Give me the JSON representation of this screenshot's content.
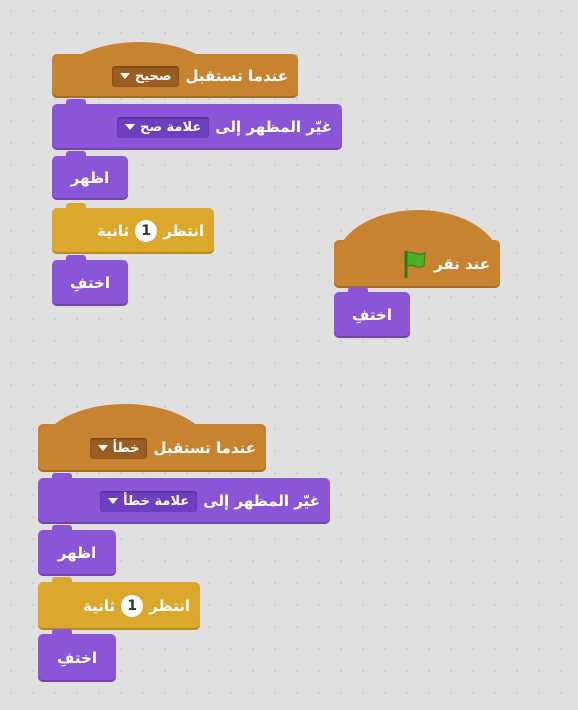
{
  "script1": {
    "when_receive_label": "عندما تستقبل",
    "message_value": "صحيح",
    "switch_label": "غيّر المظهر إلى",
    "costume_value": "علامة صح",
    "show_label": "اظهر",
    "wait_prefix": "انتظر",
    "wait_value": "1",
    "wait_suffix": "ثانية",
    "hide_label": "اختفِ"
  },
  "script2": {
    "flag_label": "عند نقر",
    "hide_label": "اختفِ"
  },
  "script3": {
    "when_receive_label": "عندما تستقبل",
    "message_value": "خطأ",
    "switch_label": "غيّر المظهر إلى",
    "costume_value": "علامة خطأ",
    "show_label": "اظهر",
    "wait_prefix": "انتظر",
    "wait_value": "1",
    "wait_suffix": "ثانية",
    "hide_label": "اختفِ"
  },
  "colors": {
    "events": "#c88330",
    "looks": "#8a55d7",
    "control": "#dba82d",
    "flag": "#4caf2a",
    "workspace": "#e0e0e0"
  },
  "icons": {
    "flag": "green-flag-icon",
    "dropdown": "dropdown-arrow-icon"
  }
}
